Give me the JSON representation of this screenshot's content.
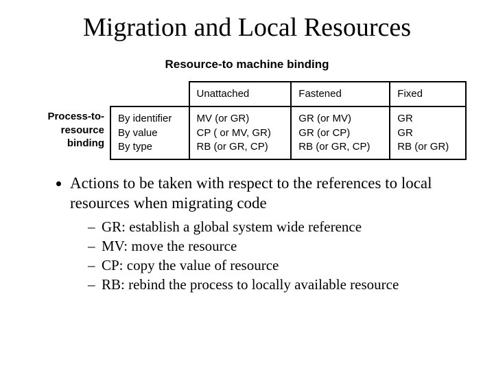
{
  "title": "Migration and Local Resources",
  "subtitle": "Resource-to machine binding",
  "rowGroupLabel": "Process-to-\nresource\nbinding",
  "table": {
    "columns": [
      "",
      "Unattached",
      "Fastened",
      "Fixed"
    ],
    "rowLabels": [
      "By identifier",
      "By value",
      "By type"
    ],
    "cells": {
      "unattached": [
        "MV (or GR)",
        "CP ( or MV, GR)",
        "RB (or GR, CP)"
      ],
      "fastened": [
        "GR (or MV)",
        "GR (or CP)",
        "RB (or GR, CP)"
      ],
      "fixed": [
        "GR",
        "GR",
        "RB (or GR)"
      ]
    }
  },
  "bullet": "Actions to be taken with respect to the references to local resources when migrating code",
  "subbullets": [
    "GR: establish a global system wide reference",
    "MV: move the resource",
    "CP: copy the value of resource",
    "RB: rebind the process to locally available resource"
  ],
  "dash": "–"
}
